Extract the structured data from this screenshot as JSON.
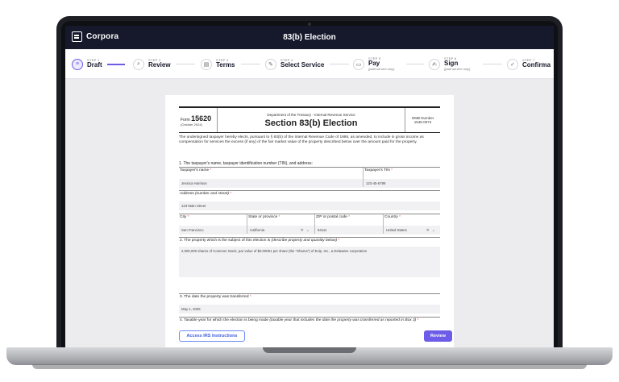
{
  "app": {
    "brand": "Corpora",
    "title": "83(b) Election"
  },
  "steps": [
    {
      "num": "STEP 1",
      "label": "Draft",
      "sub": "",
      "icon": "list-icon"
    },
    {
      "num": "STEP 2",
      "label": "Review",
      "sub": "",
      "icon": "search-icon"
    },
    {
      "num": "STEP 3",
      "label": "Terms",
      "sub": "",
      "icon": "document-icon"
    },
    {
      "num": "STEP 4",
      "label": "Select Service",
      "sub": "",
      "icon": "pen-icon"
    },
    {
      "num": "STEP 5",
      "label": "Pay",
      "sub": "(paid service only)",
      "icon": "card-icon"
    },
    {
      "num": "STEP 6",
      "label": "Sign",
      "sub": "(paid service only)",
      "icon": "signature-icon"
    },
    {
      "num": "STEP 7",
      "label": "Confirma",
      "sub": "",
      "icon": "check-icon"
    }
  ],
  "form": {
    "form_label": "Form",
    "form_number": "15620",
    "form_date": "(October 2024)",
    "department": "Department of the Treasury - Internal Revenue Service",
    "section_title": "Section 83(b) Election",
    "omb_label": "OMB Number",
    "omb_number": "1545-0074",
    "intro": "The undersigned taxpayer hereby elects, pursuant to § 83(b) of the Internal Revenue Code of 1986, as amended, to include in gross income as compensation for services the excess (if any) of the fair market value of the property described below over the amount paid for the property.",
    "q1": "1. The taxpayer's name, taxpayer identification number (TIN), and address:",
    "taxpayer_name_label": "Taxpayer's name",
    "taxpayer_name": "Jessica Harrison",
    "tin_label": "Taxpayer's TIN",
    "tin": "123-45-6789",
    "address_label": "Address",
    "address_hint": "(number and street)",
    "address": "123 Main Street",
    "city_label": "City",
    "city": "San Francisco",
    "state_label": "State or province",
    "state": "California",
    "zip_label": "ZIP or postal code",
    "zip": "94111",
    "country_label": "Country",
    "country": "United States",
    "q2": "2. The property which is the subject of this election is",
    "q2_hint": "(describe property and quantity below)",
    "property": "2,000,000 shares of Common Stock, par value of $0.00001 per share (the \"Shares\") of Evip, Inc., a Delaware corporation",
    "q3": "3. The date the property was transferred",
    "transfer_date": "May 1, 2025",
    "q4": "4. Taxable year for which the election is being made",
    "q4_hint": "(taxable year that includes the date the property was transferred as reported in Box 3)",
    "required_mark": "*",
    "clear_glyph": "✕",
    "chevron_glyph": "⌄"
  },
  "buttons": {
    "irs": "Access IRS Instructions",
    "review": "Review"
  },
  "colors": {
    "accent": "#6c5ce7",
    "topbar": "#15192b",
    "link": "#3c5ddf"
  }
}
